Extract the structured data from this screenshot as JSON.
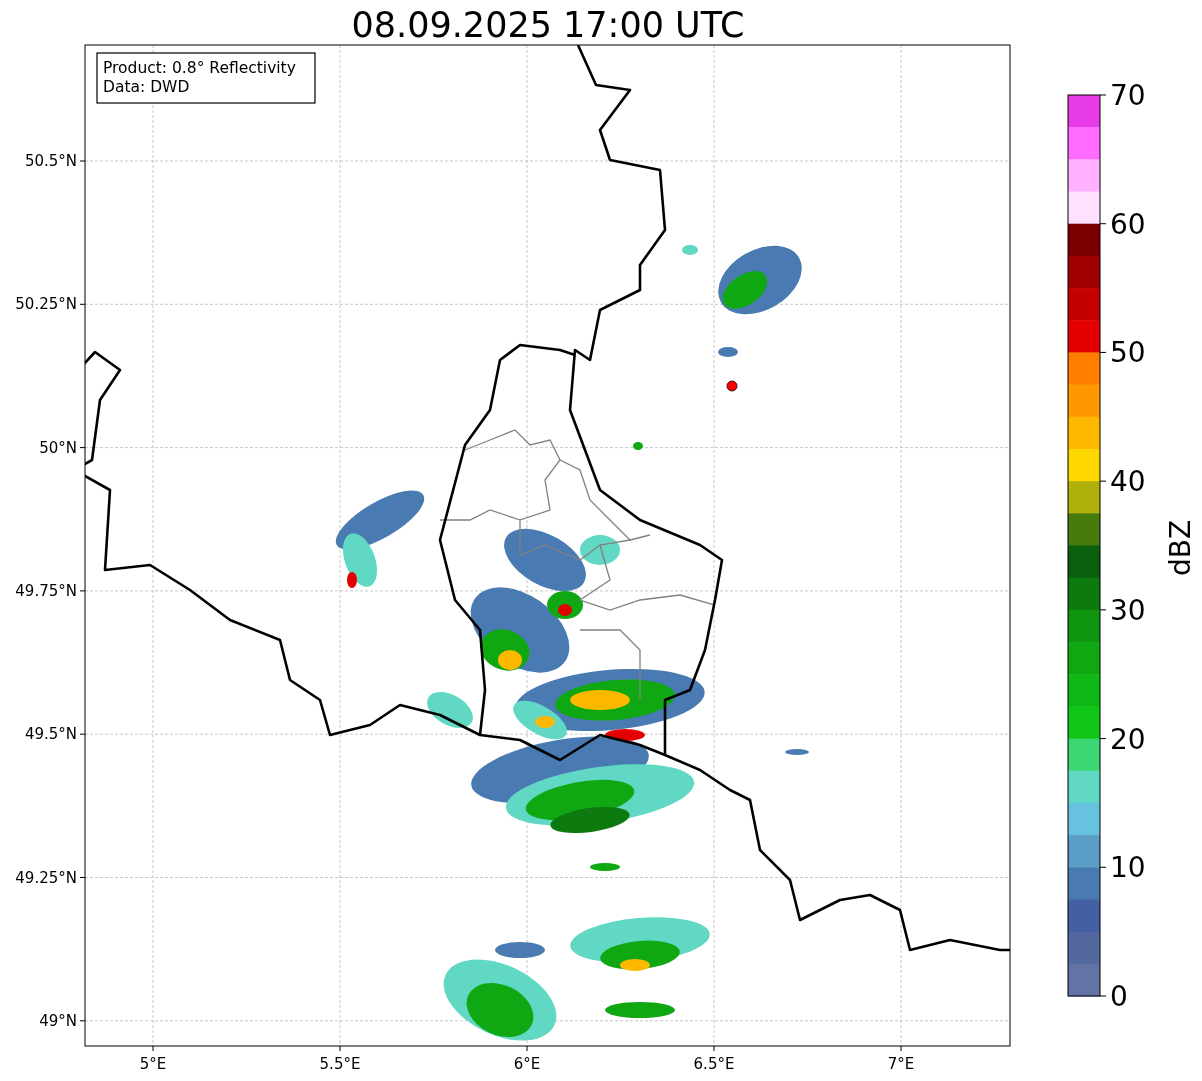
{
  "title": "08.09.2025 17:00 UTC",
  "info_box": {
    "lines": [
      "Product: 0.8° Reflectivity",
      "Data: DWD"
    ]
  },
  "map": {
    "x_ticks": [
      "5°E",
      "5.5°E",
      "6°E",
      "6.5°E",
      "7°E"
    ],
    "y_ticks": [
      "50.5°N",
      "50.25°N",
      "50°N",
      "49.75°N",
      "49.5°N",
      "49.25°N",
      "49°N"
    ]
  },
  "colorbar": {
    "label": "dBZ",
    "ticks": [
      "70",
      "60",
      "50",
      "40",
      "30",
      "20",
      "10",
      "0"
    ],
    "segments": [
      {
        "color": "#e83ce8"
      },
      {
        "color": "#ff6bff"
      },
      {
        "color": "#ffb0ff"
      },
      {
        "color": "#ffe0ff"
      },
      {
        "color": "#7a0000"
      },
      {
        "color": "#a00000"
      },
      {
        "color": "#c40000"
      },
      {
        "color": "#e40000"
      },
      {
        "color": "#ff7e00"
      },
      {
        "color": "#ff9800"
      },
      {
        "color": "#ffb800"
      },
      {
        "color": "#ffd800"
      },
      {
        "color": "#b0b00a"
      },
      {
        "color": "#477b0c"
      },
      {
        "color": "#0a5f0e"
      },
      {
        "color": "#0d7a0f"
      },
      {
        "color": "#0f9510"
      },
      {
        "color": "#10a812"
      },
      {
        "color": "#10b815"
      },
      {
        "color": "#10c718"
      },
      {
        "color": "#3cd672"
      },
      {
        "color": "#60d8c4"
      },
      {
        "color": "#66c2de"
      },
      {
        "color": "#5a9ec8"
      },
      {
        "color": "#4a7ab2"
      },
      {
        "color": "#4360a5"
      },
      {
        "color": "#5468a0"
      },
      {
        "color": "#6373a6"
      }
    ]
  }
}
